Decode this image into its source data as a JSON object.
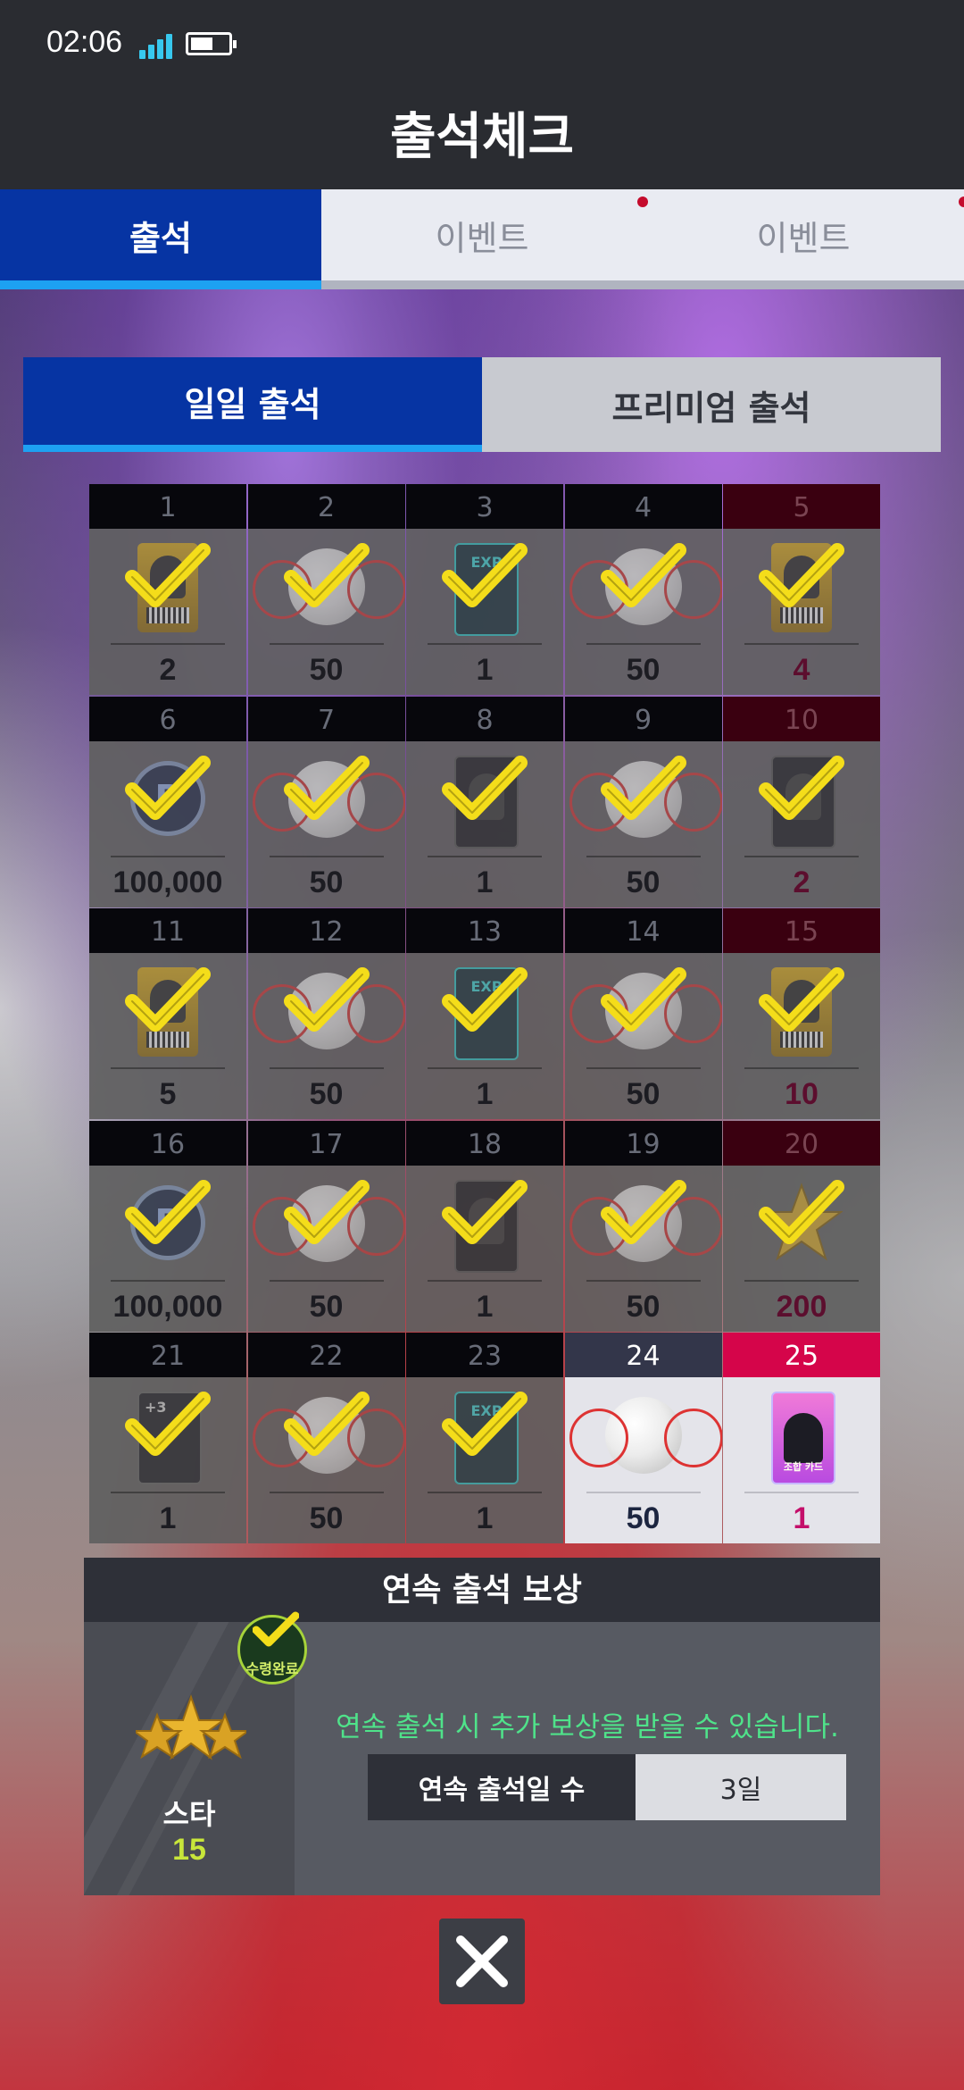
{
  "status_bar": {
    "time": "02:06"
  },
  "header": {
    "title": "출석체크"
  },
  "tabs": [
    {
      "label": "출석",
      "active": true,
      "dot": false
    },
    {
      "label": "이벤트",
      "active": false,
      "dot": true
    },
    {
      "label": "이벤트",
      "active": false,
      "dot": true
    }
  ],
  "subtabs": [
    {
      "label": "일일 출석",
      "active": true
    },
    {
      "label": "프리미엄 출석",
      "active": false
    }
  ],
  "days": [
    {
      "day": "1",
      "qty": "2",
      "icon": "player-card-gold-icon",
      "checked": true,
      "special": false
    },
    {
      "day": "2",
      "qty": "50",
      "icon": "baseball-icon",
      "checked": true,
      "special": false
    },
    {
      "day": "3",
      "qty": "1",
      "icon": "exp-card-icon",
      "checked": true,
      "special": false
    },
    {
      "day": "4",
      "qty": "50",
      "icon": "baseball-icon",
      "checked": true,
      "special": false
    },
    {
      "day": "5",
      "qty": "4",
      "icon": "player-card-gold-icon",
      "checked": true,
      "special": true
    },
    {
      "day": "6",
      "qty": "100,000",
      "icon": "coin-icon",
      "checked": true,
      "special": false
    },
    {
      "day": "7",
      "qty": "50",
      "icon": "baseball-icon",
      "checked": true,
      "special": false
    },
    {
      "day": "8",
      "qty": "1",
      "icon": "player-card-dark-icon",
      "checked": true,
      "special": false
    },
    {
      "day": "9",
      "qty": "50",
      "icon": "baseball-icon",
      "checked": true,
      "special": false
    },
    {
      "day": "10",
      "qty": "2",
      "icon": "player-card-dark-icon",
      "checked": true,
      "special": true
    },
    {
      "day": "11",
      "qty": "5",
      "icon": "player-card-gold-icon",
      "checked": true,
      "special": false
    },
    {
      "day": "12",
      "qty": "50",
      "icon": "baseball-icon",
      "checked": true,
      "special": false
    },
    {
      "day": "13",
      "qty": "1",
      "icon": "exp-card-icon",
      "checked": true,
      "special": false
    },
    {
      "day": "14",
      "qty": "50",
      "icon": "baseball-icon",
      "checked": true,
      "special": false
    },
    {
      "day": "15",
      "qty": "10",
      "icon": "player-card-gold-icon",
      "checked": true,
      "special": true
    },
    {
      "day": "16",
      "qty": "100,000",
      "icon": "coin-icon",
      "checked": true,
      "special": false
    },
    {
      "day": "17",
      "qty": "50",
      "icon": "baseball-icon",
      "checked": true,
      "special": false
    },
    {
      "day": "18",
      "qty": "1",
      "icon": "player-card-dark-icon",
      "checked": true,
      "special": false
    },
    {
      "day": "19",
      "qty": "50",
      "icon": "baseball-icon",
      "checked": true,
      "special": false
    },
    {
      "day": "20",
      "qty": "200",
      "icon": "star-icon",
      "checked": true,
      "special": true
    },
    {
      "day": "21",
      "qty": "1",
      "icon": "upgrade-card-icon",
      "checked": true,
      "special": false
    },
    {
      "day": "22",
      "qty": "50",
      "icon": "baseball-icon",
      "checked": true,
      "special": false
    },
    {
      "day": "23",
      "qty": "1",
      "icon": "exp-card-icon",
      "checked": true,
      "special": false
    },
    {
      "day": "24",
      "qty": "50",
      "icon": "baseball-icon",
      "checked": false,
      "special": false,
      "today": true
    },
    {
      "day": "25",
      "qty": "1",
      "icon": "combo-card-icon",
      "checked": false,
      "special": true,
      "today": true,
      "card_text": "조합 카드"
    }
  ],
  "bonus": {
    "title": "연속 출석 보상",
    "reward_name": "스타",
    "reward_count": "15",
    "badge": "수령완료",
    "message": "연속 출석 시 추가 보상을 받을 수 있습니다.",
    "streak_label": "연속 출석일 수",
    "streak_value": "3일"
  },
  "colors": {
    "primary_blue": "#0634a3",
    "accent_cyan": "#1da1f2",
    "check_yellow": "#f4dd1a",
    "special_pink": "#d5054a",
    "message_green": "#4fe38a"
  }
}
